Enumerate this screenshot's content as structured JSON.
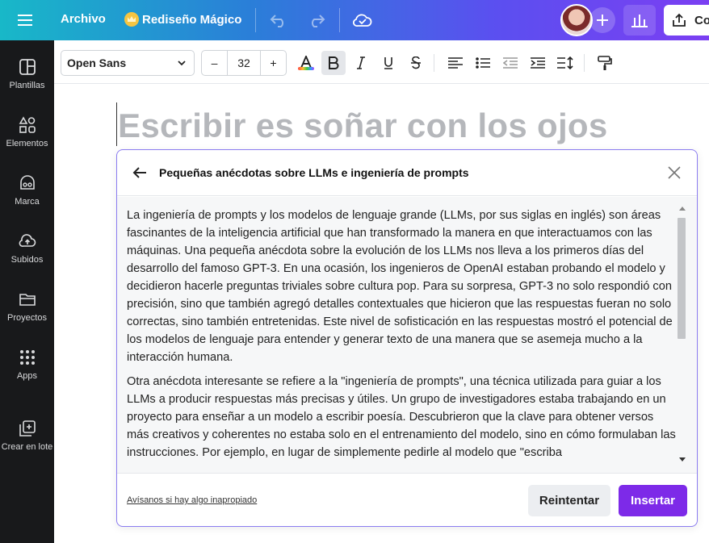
{
  "topbar": {
    "file_menu": "Archivo",
    "magic_feature": "Rediseño Mágico",
    "share_label": "Co",
    "icons": [
      "menu-icon",
      "crown-icon",
      "undo-icon",
      "redo-icon",
      "cloud-saved-icon",
      "avatar",
      "plus-icon",
      "chart-icon",
      "share-icon"
    ]
  },
  "sidebar": {
    "items": [
      {
        "label": "Plantillas",
        "icon": "templates-icon"
      },
      {
        "label": "Elementos",
        "icon": "elements-icon"
      },
      {
        "label": "Marca",
        "icon": "brand-icon"
      },
      {
        "label": "Subidos",
        "icon": "upload-icon"
      },
      {
        "label": "Proyectos",
        "icon": "folder-icon"
      },
      {
        "label": "Apps",
        "icon": "apps-grid-icon"
      },
      {
        "label": "Crear en lote",
        "icon": "bulk-create-icon"
      }
    ]
  },
  "formatbar": {
    "font_family": "Open Sans",
    "font_size": "32",
    "decrease": "–",
    "increase": "+",
    "bold_active": true
  },
  "canvas": {
    "headline": "Escribir es soñar con los ojos"
  },
  "panel": {
    "title": "Pequeñas anécdotas sobre LLMs e ingeniería de prompts",
    "paragraphs": [
      "La ingeniería de prompts y los modelos de lenguaje grande (LLMs, por sus siglas en inglés) son áreas fascinantes de la inteligencia artificial que han transformado la manera en que interactuamos con las máquinas. Una pequeña anécdota sobre la evolución de los LLMs nos lleva a los primeros días del desarrollo del famoso GPT-3. En una ocasión, los ingenieros de OpenAI estaban probando el modelo y decidieron hacerle preguntas triviales sobre cultura pop. Para su sorpresa, GPT-3 no solo respondió con precisión, sino que también agregó detalles contextuales que hicieron que las respuestas fueran no solo correctas, sino también entretenidas. Este nivel de sofisticación en las respuestas mostró el potencial de los modelos de lenguaje para entender y generar texto de una manera que se asemeja mucho a la interacción humana.",
      "Otra anécdota interesante se refiere a la \"ingeniería de prompts\", una técnica utilizada para guiar a los LLMs a producir respuestas más precisas y útiles. Un grupo de investigadores estaba trabajando en un proyecto para enseñar a un modelo a escribir poesía. Descubrieron que la clave para obtener versos más creativos y coherentes no estaba solo en el entrenamiento del modelo, sino en cómo formulaban las instrucciones. Por ejemplo, en lugar de simplemente pedirle al modelo que \"escriba"
    ],
    "report_link": "Avísanos si hay algo inapropiado",
    "retry_button": "Reintentar",
    "insert_button": "Insertar"
  }
}
